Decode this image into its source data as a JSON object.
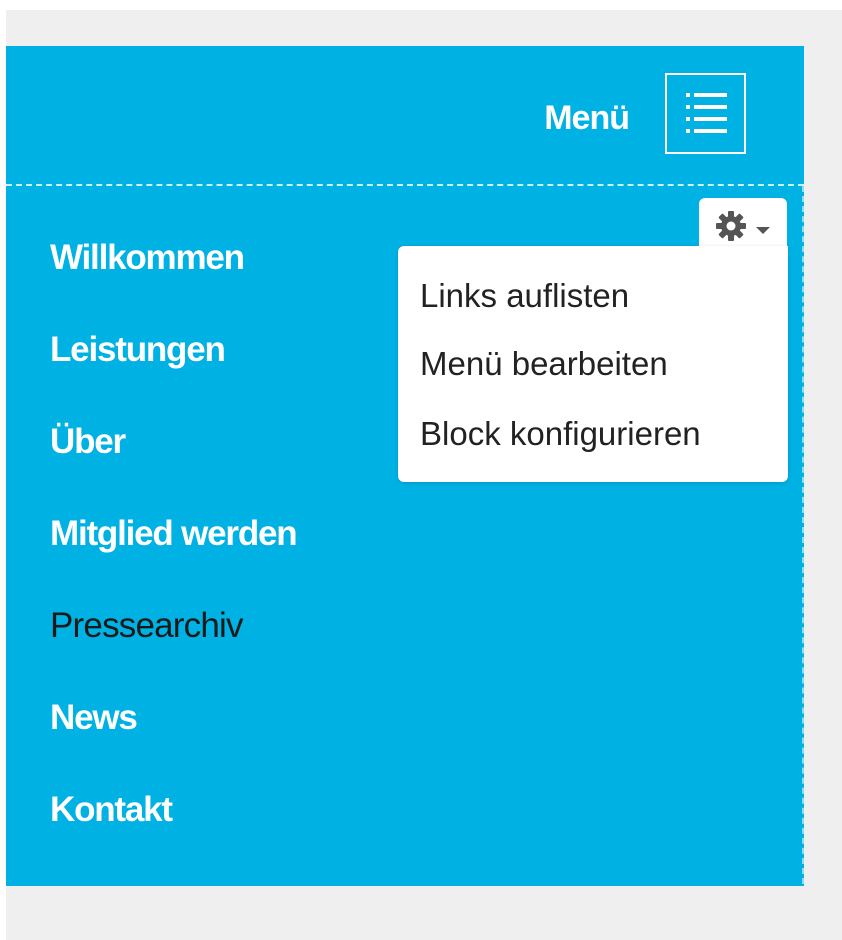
{
  "header": {
    "menu_label": "Menü"
  },
  "nav": {
    "items": [
      {
        "label": "Willkommen",
        "active": false
      },
      {
        "label": "Leistungen",
        "active": false
      },
      {
        "label": "Über",
        "active": false
      },
      {
        "label": "Mitglied werden",
        "active": false
      },
      {
        "label": "Pressearchiv",
        "active": true
      },
      {
        "label": "News",
        "active": false
      },
      {
        "label": "Kontakt",
        "active": false
      }
    ]
  },
  "contextual_menu": {
    "icon": "gear-icon",
    "items": [
      {
        "label": "Links auflisten"
      },
      {
        "label": "Menü bearbeiten"
      },
      {
        "label": "Block konfigurieren"
      }
    ]
  },
  "colors": {
    "panel": "#00b1e4",
    "page_background": "#efefef",
    "nav_text": "#ffffff",
    "active_text": "#1a1a1a"
  },
  "icons": {
    "menu_toggle": "hamburger-list-icon",
    "dropdown_toggle": "chevron-down-icon"
  }
}
